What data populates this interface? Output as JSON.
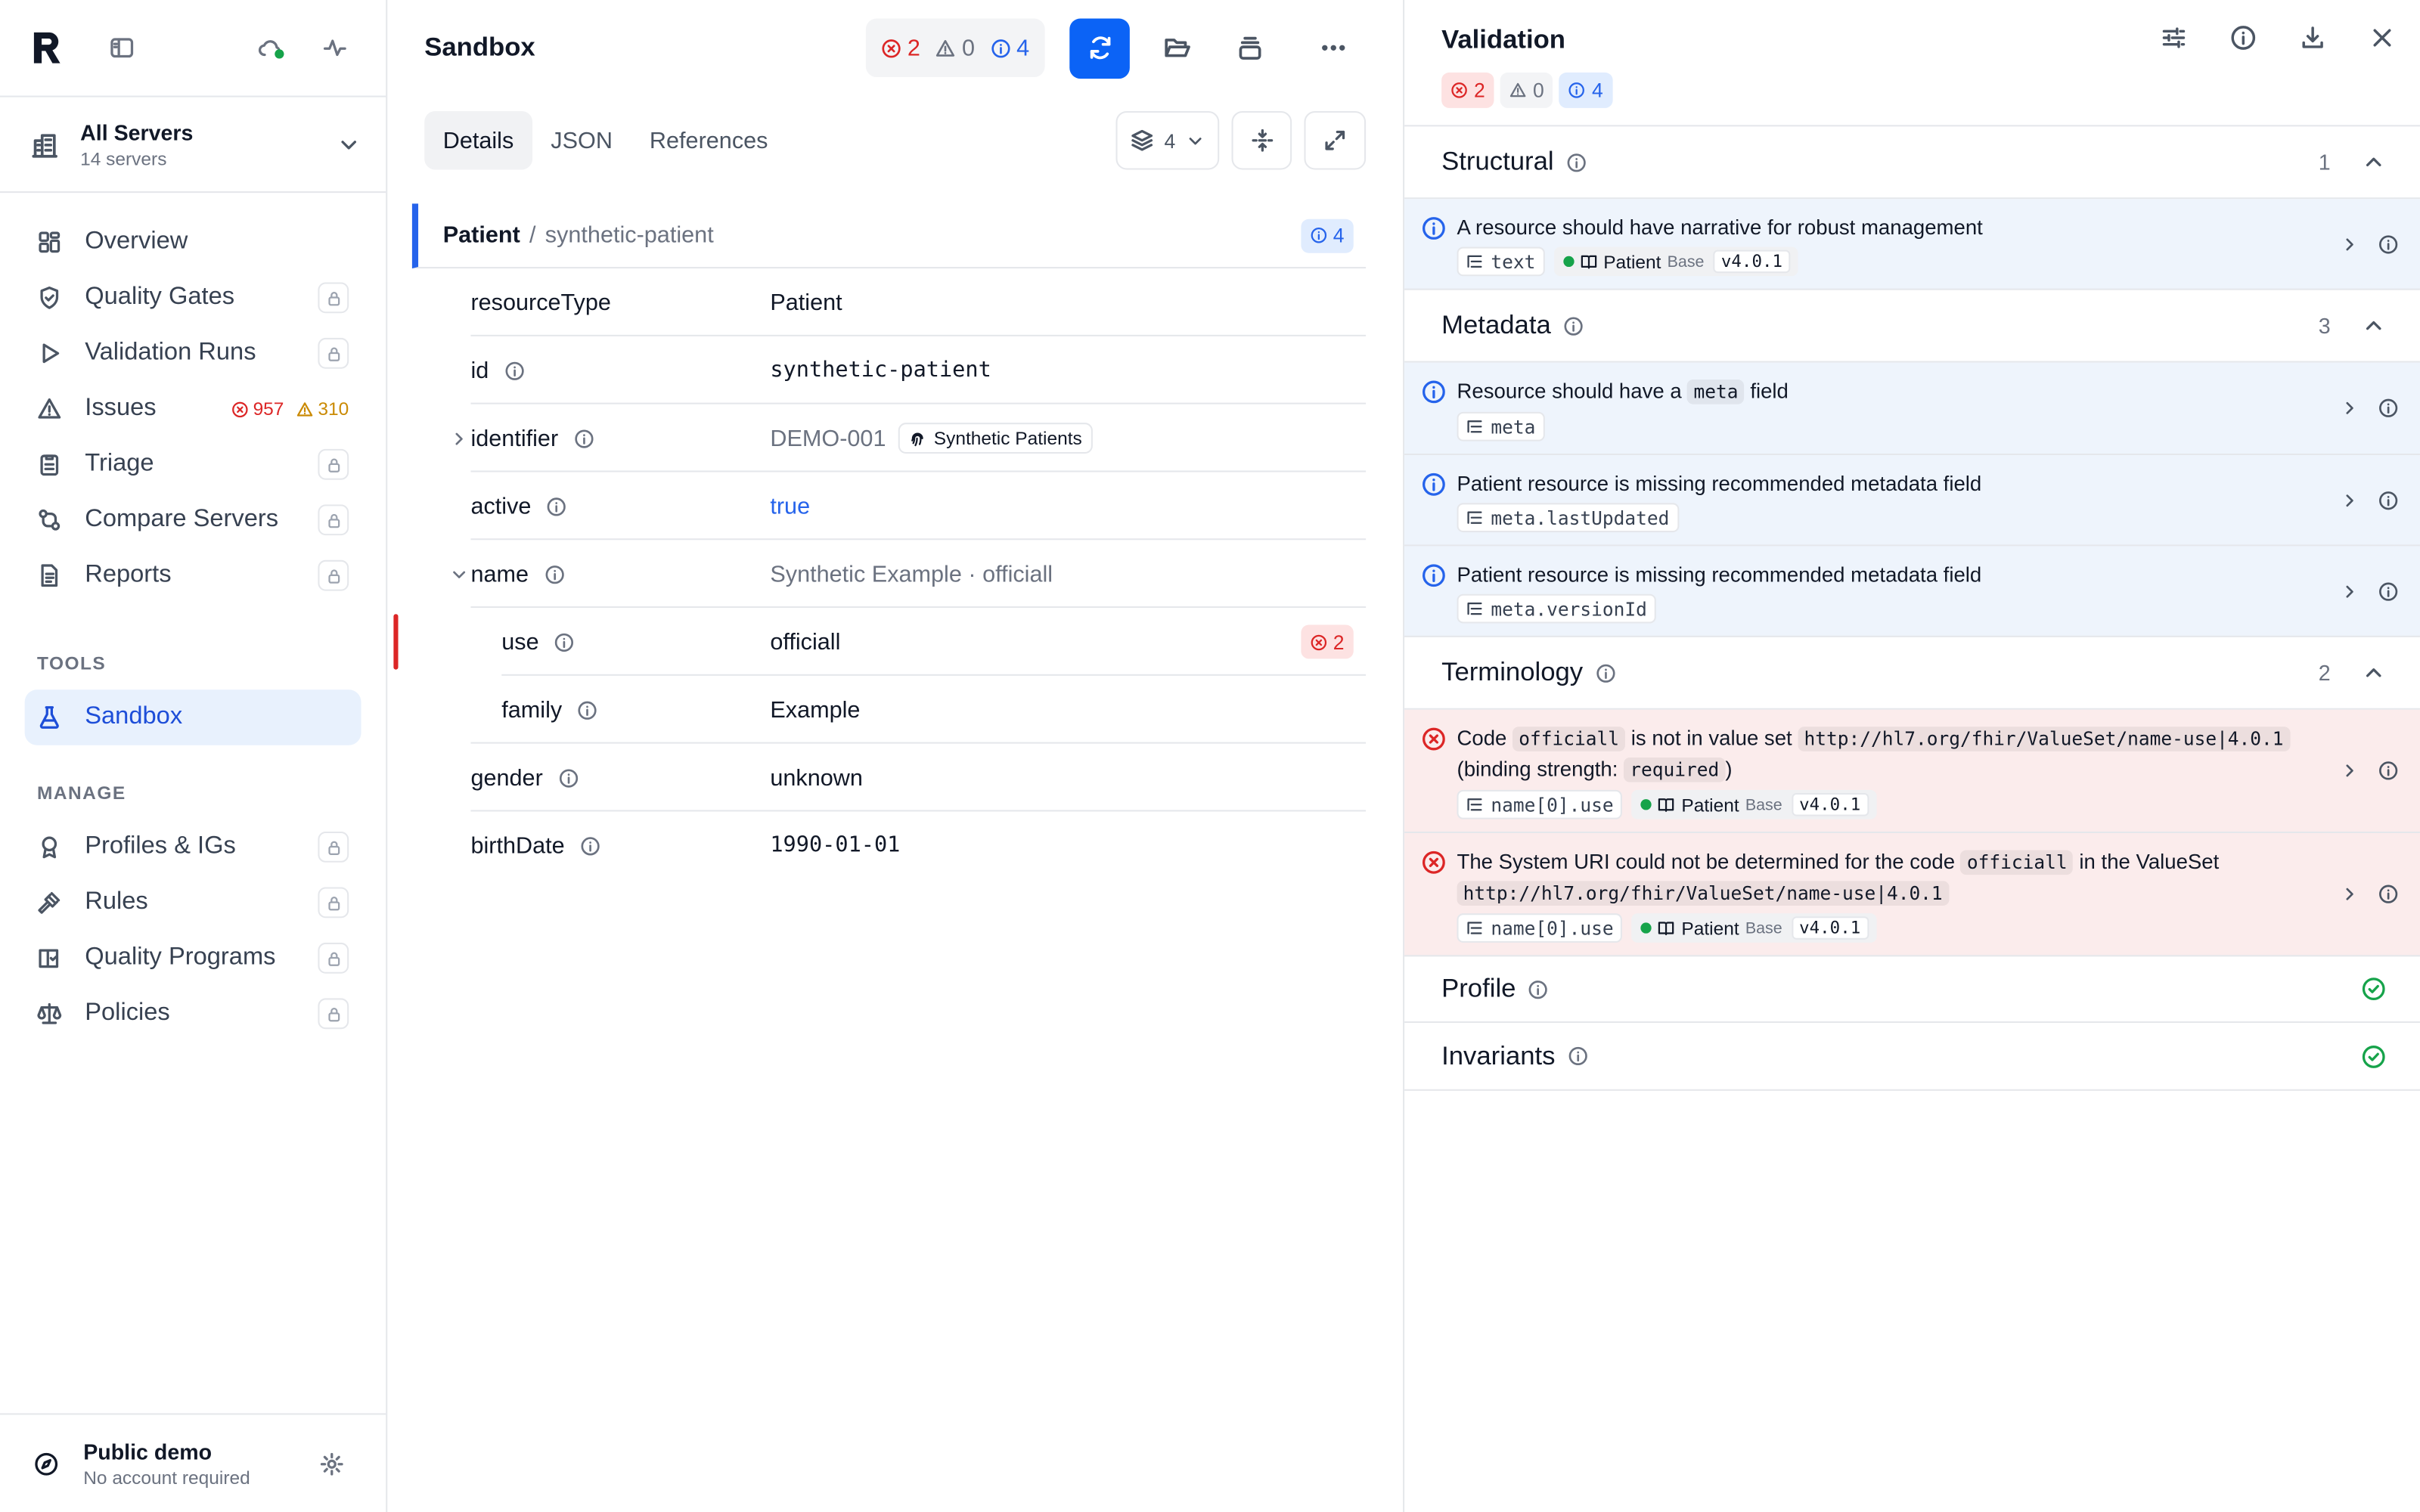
{
  "sidebar": {
    "server": {
      "name": "All Servers",
      "count": "14 servers"
    },
    "nav": [
      {
        "label": "Overview"
      },
      {
        "label": "Quality Gates"
      },
      {
        "label": "Validation Runs"
      },
      {
        "label": "Issues",
        "errors": "957",
        "warnings": "310"
      },
      {
        "label": "Triage"
      },
      {
        "label": "Compare Servers"
      },
      {
        "label": "Reports"
      }
    ],
    "tools_label": "TOOLS",
    "tools": [
      {
        "label": "Sandbox"
      }
    ],
    "manage_label": "MANAGE",
    "manage": [
      {
        "label": "Profiles & IGs"
      },
      {
        "label": "Rules"
      },
      {
        "label": "Quality Programs"
      },
      {
        "label": "Policies"
      }
    ],
    "account": {
      "title": "Public demo",
      "subtitle": "No account required"
    }
  },
  "main": {
    "title": "Sandbox",
    "counts": {
      "errors": "2",
      "warnings": "0",
      "info": "4"
    },
    "tabs": [
      "Details",
      "JSON",
      "References"
    ],
    "layers_count": "4",
    "resource": {
      "type": "Patient",
      "sep": "/",
      "id": "synthetic-patient",
      "info_count": "4"
    },
    "fields": {
      "resourceType": {
        "key": "resourceType",
        "value": "Patient"
      },
      "id": {
        "key": "id",
        "value": "synthetic-patient"
      },
      "identifier": {
        "key": "identifier",
        "value": "DEMO-001",
        "tag": "Synthetic Patients"
      },
      "active": {
        "key": "active",
        "value": "true"
      },
      "name": {
        "key": "name",
        "value": "Synthetic Example · officiall"
      },
      "use": {
        "key": "use",
        "value": "officiall",
        "errors": "2"
      },
      "family": {
        "key": "family",
        "value": "Example"
      },
      "gender": {
        "key": "gender",
        "value": "unknown"
      },
      "birthDate": {
        "key": "birthDate",
        "value": "1990-01-01"
      }
    }
  },
  "panel": {
    "title": "Validation",
    "counts": {
      "errors": "2",
      "warnings": "0",
      "info": "4"
    },
    "groups": {
      "structural": {
        "title": "Structural",
        "count": "1",
        "issues": [
          {
            "message": "A resource should have narrative for robust management",
            "path": "text",
            "profile": "Patient",
            "base": "Base",
            "version": "v4.0.1"
          }
        ]
      },
      "metadata": {
        "title": "Metadata",
        "count": "3",
        "issues": [
          {
            "pre": "Resource should have a",
            "code": "meta",
            "post": "field",
            "path": "meta"
          },
          {
            "message": "Patient resource is missing recommended metadata field",
            "path": "meta.lastUpdated"
          },
          {
            "message": "Patient resource is missing recommended metadata field",
            "path": "meta.versionId"
          }
        ]
      },
      "terminology": {
        "title": "Terminology",
        "count": "2",
        "issues": [
          {
            "p1": "Code",
            "c1": "officiall",
            "p2": "is not in value set",
            "c2": "http://hl7.org/fhir/ValueSet/name-use|4.0.1",
            "p3": "(binding strength:",
            "c3": "required",
            "p4": ")",
            "path": "name[0].use",
            "profile": "Patient",
            "base": "Base",
            "version": "v4.0.1"
          },
          {
            "p1": "The System URI could not be determined for the code",
            "c1": "officiall",
            "p2": "in the ValueSet",
            "c2": "http://hl7.org/fhir/ValueSet/name-use|4.0.1",
            "path": "name[0].use",
            "profile": "Patient",
            "base": "Base",
            "version": "v4.0.1"
          }
        ]
      },
      "profile": {
        "title": "Profile"
      },
      "invariants": {
        "title": "Invariants"
      }
    }
  },
  "colors": {
    "accent": "#0b63f6",
    "error": "#dc2626",
    "warning": "#ca8a04",
    "info": "#2563eb",
    "success": "#16a34a",
    "active_nav_bg": "#e8f1fd"
  }
}
